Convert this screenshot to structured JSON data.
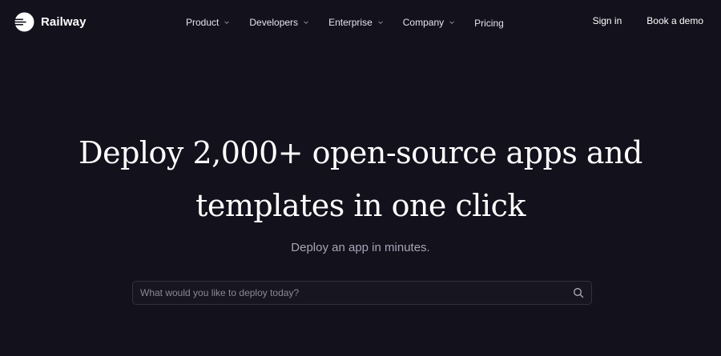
{
  "brand": {
    "name": "Railway",
    "icon": "railway-logo-icon"
  },
  "nav": {
    "items": [
      {
        "label": "Product",
        "has_dropdown": true
      },
      {
        "label": "Developers",
        "has_dropdown": true
      },
      {
        "label": "Enterprise",
        "has_dropdown": true
      },
      {
        "label": "Company",
        "has_dropdown": true
      },
      {
        "label": "Pricing",
        "has_dropdown": false
      }
    ]
  },
  "header_actions": {
    "sign_in": "Sign in",
    "book_demo": "Book a demo"
  },
  "hero": {
    "title_line1": "Deploy 2,000+ open-source apps and",
    "title_line2": "templates in one click",
    "subtitle": "Deploy an app in minutes."
  },
  "search": {
    "placeholder": "What would you like to deploy today?",
    "value": "",
    "icon": "search-icon"
  },
  "colors": {
    "background": "#13111c",
    "text_primary": "#ffffff",
    "text_muted": "#a8a4b6",
    "input_border": "#34313f"
  }
}
